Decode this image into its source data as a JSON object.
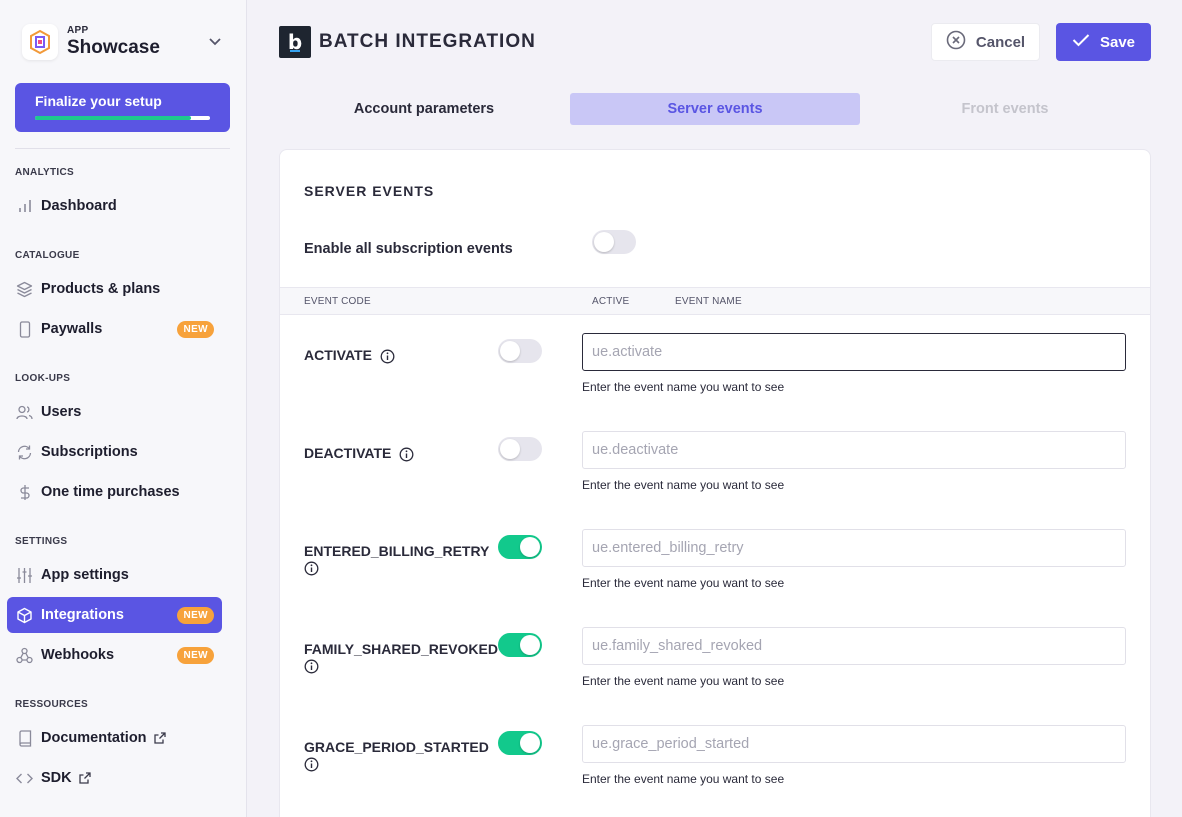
{
  "sidebar": {
    "app_kicker": "APP",
    "app_name": "Showcase",
    "finalize": {
      "label": "Finalize your setup",
      "progress": 0.89
    },
    "sections": {
      "analytics": "ANALYTICS",
      "catalogue": "CATALOGUE",
      "lookups": "LOOK-UPS",
      "settings": "SETTINGS",
      "resources": "RESSOURCES"
    },
    "items": {
      "dashboard": "Dashboard",
      "products": "Products & plans",
      "paywalls": "Paywalls",
      "users": "Users",
      "subscriptions": "Subscriptions",
      "one_time": "One time purchases",
      "app_settings": "App settings",
      "integrations": "Integrations",
      "webhooks": "Webhooks",
      "documentation": "Documentation",
      "sdk": "SDK"
    },
    "badge_new": "NEW"
  },
  "header": {
    "title": "BATCH INTEGRATION",
    "cancel_label": "Cancel",
    "save_label": "Save"
  },
  "tabs": {
    "account": "Account parameters",
    "server": "Server events",
    "front": "Front events"
  },
  "card": {
    "title": "SERVER EVENTS",
    "enable_all_label": "Enable all subscription events",
    "enable_all_on": false,
    "columns": {
      "event_code": "EVENT CODE",
      "active": "ACTIVE",
      "event_name": "EVENT NAME"
    },
    "hint": "Enter the event name you want to see",
    "events": [
      {
        "code": "ACTIVATE",
        "active": false,
        "placeholder": "ue.activate"
      },
      {
        "code": "DEACTIVATE",
        "active": false,
        "placeholder": "ue.deactivate"
      },
      {
        "code": "ENTERED_BILLING_RETRY",
        "active": true,
        "placeholder": "ue.entered_billing_retry"
      },
      {
        "code": "FAMILY_SHARED_REVOKED",
        "active": true,
        "placeholder": "ue.family_shared_revoked"
      },
      {
        "code": "GRACE_PERIOD_STARTED",
        "active": true,
        "placeholder": "ue.grace_period_started"
      }
    ]
  },
  "colors": {
    "accent": "#5a55e3",
    "toggle_on": "#12c98c",
    "badge": "#f7a23b",
    "progress": "#1fc98e"
  }
}
